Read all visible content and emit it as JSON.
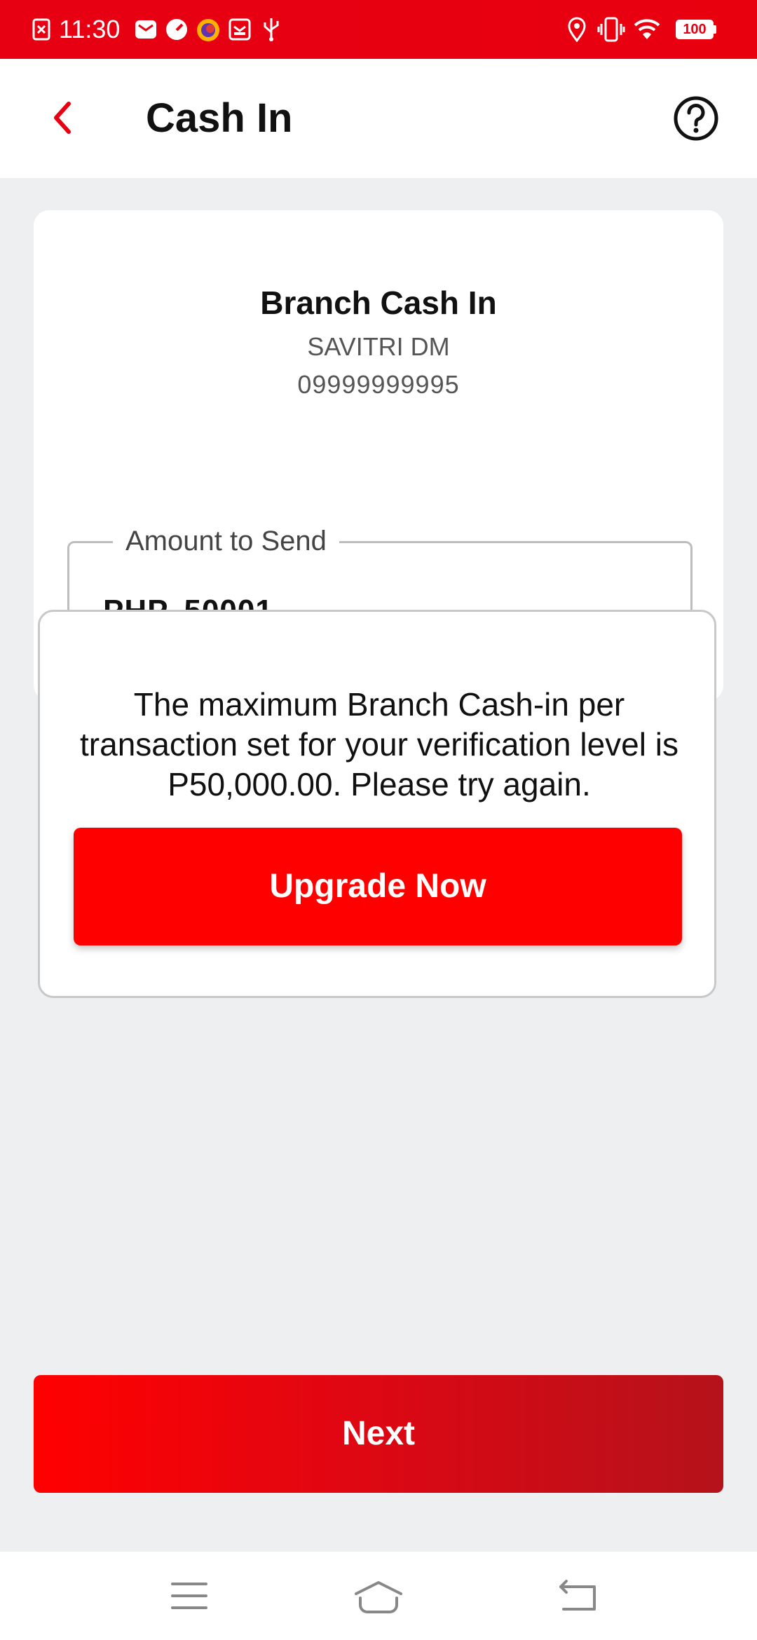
{
  "status_bar": {
    "time": "11:30",
    "battery": "100"
  },
  "header": {
    "title": "Cash In"
  },
  "card": {
    "title": "Branch Cash In",
    "name": "SAVITRI DM",
    "number": "09999999995",
    "amount_label": "Amount to Send",
    "amount_currency": "PHP",
    "amount_value": "50001"
  },
  "popup": {
    "message": "The maximum Branch Cash-in per transaction set for your verification level is P50,000.00. Please try again.",
    "button_label": "Upgrade Now"
  },
  "footer": {
    "next_label": "Next"
  },
  "colors": {
    "brand_red": "#FF0000",
    "status_bar_red": "#E60012",
    "background": "#EEEFF1"
  },
  "icons": {
    "back": "chevron-left-icon",
    "help": "question-circle-icon",
    "nav_menu": "menu-icon",
    "nav_home": "home-icon",
    "nav_back": "back-icon"
  }
}
